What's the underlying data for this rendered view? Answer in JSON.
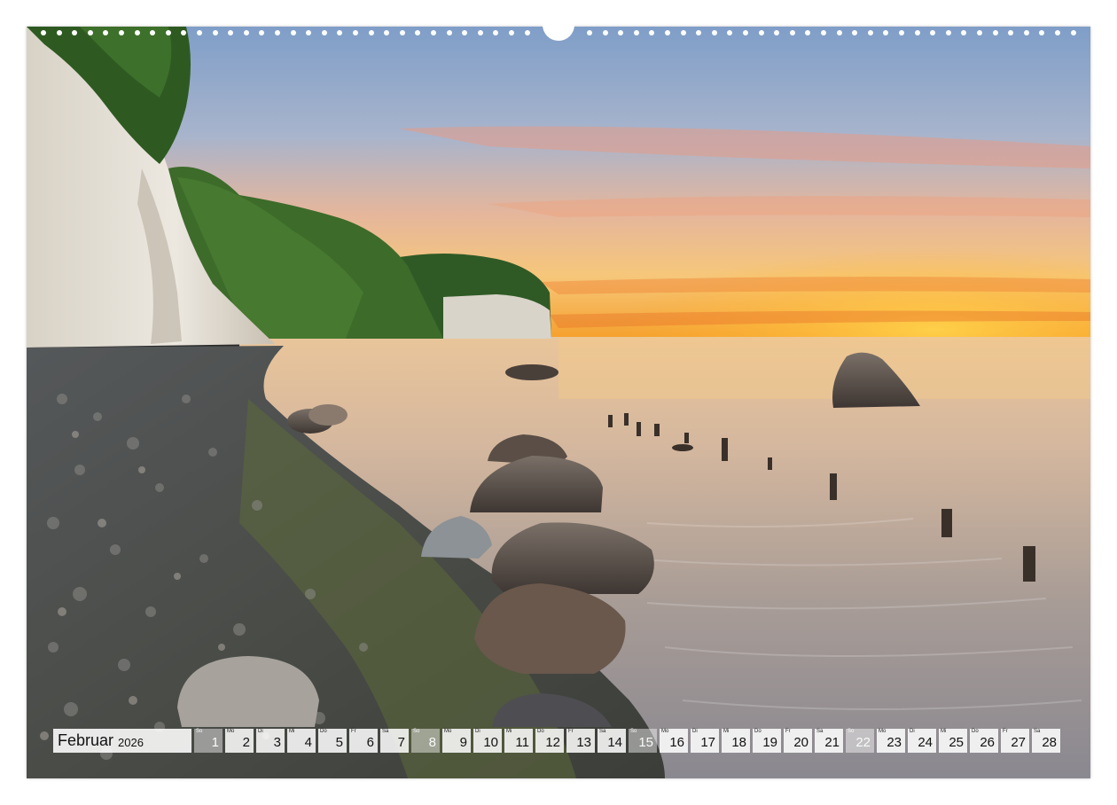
{
  "calendar": {
    "month": "Februar",
    "year": "2026",
    "days": [
      {
        "wd": "So",
        "num": "1",
        "hl": true
      },
      {
        "wd": "Mo",
        "num": "2"
      },
      {
        "wd": "Di",
        "num": "3"
      },
      {
        "wd": "Mi",
        "num": "4"
      },
      {
        "wd": "Do",
        "num": "5"
      },
      {
        "wd": "Fr",
        "num": "6"
      },
      {
        "wd": "Sa",
        "num": "7"
      },
      {
        "wd": "So",
        "num": "8",
        "hl": true
      },
      {
        "wd": "Mo",
        "num": "9"
      },
      {
        "wd": "Di",
        "num": "10"
      },
      {
        "wd": "Mi",
        "num": "11"
      },
      {
        "wd": "Do",
        "num": "12"
      },
      {
        "wd": "Fr",
        "num": "13"
      },
      {
        "wd": "Sa",
        "num": "14"
      },
      {
        "wd": "So",
        "num": "15",
        "hl": true
      },
      {
        "wd": "Mo",
        "num": "16"
      },
      {
        "wd": "Di",
        "num": "17"
      },
      {
        "wd": "Mi",
        "num": "18"
      },
      {
        "wd": "Do",
        "num": "19"
      },
      {
        "wd": "Fr",
        "num": "20"
      },
      {
        "wd": "Sa",
        "num": "21"
      },
      {
        "wd": "So",
        "num": "22",
        "hl": true
      },
      {
        "wd": "Mo",
        "num": "23"
      },
      {
        "wd": "Di",
        "num": "24"
      },
      {
        "wd": "Mi",
        "num": "25"
      },
      {
        "wd": "Do",
        "num": "26"
      },
      {
        "wd": "Fr",
        "num": "27"
      },
      {
        "wd": "Sa",
        "num": "28"
      }
    ]
  },
  "colors": {
    "sky_top": "#7f9ec8",
    "sunset": "#f5a623",
    "cliff": "#e8e4dc",
    "forest": "#3d6b2a",
    "sea": "#b9a89a",
    "weekend_cell": "#d9d9d9"
  }
}
